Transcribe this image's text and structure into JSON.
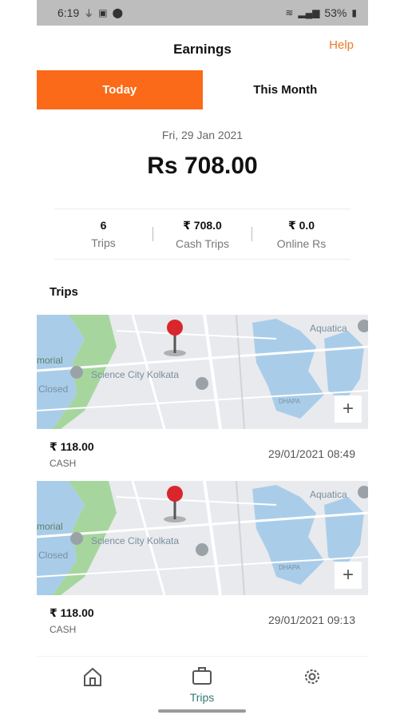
{
  "status_bar": {
    "time": "6:19",
    "battery": "53%",
    "icons_left": [
      "usb-icon",
      "image-icon",
      "location-icon"
    ],
    "icons_right": [
      "wifi-icon",
      "signal-icon",
      "battery-icon"
    ]
  },
  "header": {
    "title": "Earnings",
    "help": "Help"
  },
  "tabs": [
    {
      "label": "Today",
      "active": true
    },
    {
      "label": "This Month",
      "active": false
    }
  ],
  "summary": {
    "date": "Fri, 29 Jan 2021",
    "total": "Rs 708.00"
  },
  "stats": [
    {
      "value": "6",
      "label": "Trips"
    },
    {
      "value": "₹ 708.0",
      "label": "Cash Trips"
    },
    {
      "value": "₹ 0.0",
      "label": "Online Rs"
    }
  ],
  "trips_title": "Trips",
  "map_labels": {
    "place1": "Science City Kolkata",
    "place2": "Aquatica",
    "place3": "morial",
    "place4": "Closed",
    "place5": "DHAPA"
  },
  "trips": [
    {
      "amount": "₹ 118.00",
      "mode": "CASH",
      "datetime": "29/01/2021 08:49"
    },
    {
      "amount": "₹ 118.00",
      "mode": "CASH",
      "datetime": "29/01/2021 09:13"
    }
  ],
  "nav": {
    "home": "",
    "trips": "Trips",
    "settings": ""
  },
  "colors": {
    "accent": "#fa6a18",
    "nav_active": "#2e7b72",
    "help": "#ee7a2a"
  }
}
